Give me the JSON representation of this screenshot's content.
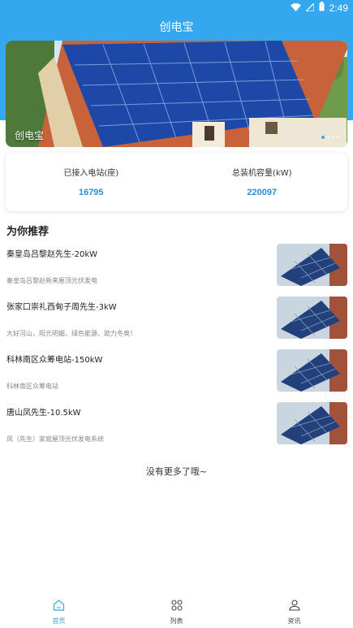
{
  "status_bar": {
    "time": "2:49"
  },
  "header": {
    "title": "创电宝"
  },
  "banner": {
    "caption": "创电宝"
  },
  "stats": [
    {
      "label": "已接入电站(座)",
      "value": "16795"
    },
    {
      "label": "总装机容量(kW)",
      "value": "220097"
    }
  ],
  "recommend": {
    "title": "为你推荐",
    "items": [
      {
        "title": "秦皇岛吕黎赵先生-20kW",
        "desc": "秦皇岛吕黎赵新来屋顶光伏发电"
      },
      {
        "title": "张家口崇礼西甸子周先生-3kW",
        "desc": "大好河山，阳光明媚，绿色能源，助力冬奥！"
      },
      {
        "title": "科林南区众筹电站-150kW",
        "desc": "科林南区众筹电站"
      },
      {
        "title": "唐山凤先生-10.5kW",
        "desc": "凤（先生）家庭屋顶光伏发电系统"
      }
    ],
    "no_more": "没有更多了哦~"
  },
  "tabs": [
    {
      "label": "首页",
      "icon": "home-icon",
      "active": true
    },
    {
      "label": "列表",
      "icon": "grid-icon",
      "active": false
    },
    {
      "label": "资讯",
      "icon": "user-icon",
      "active": false
    }
  ],
  "colors": {
    "accent": "#35a7ee",
    "value": "#2d8fd8"
  }
}
